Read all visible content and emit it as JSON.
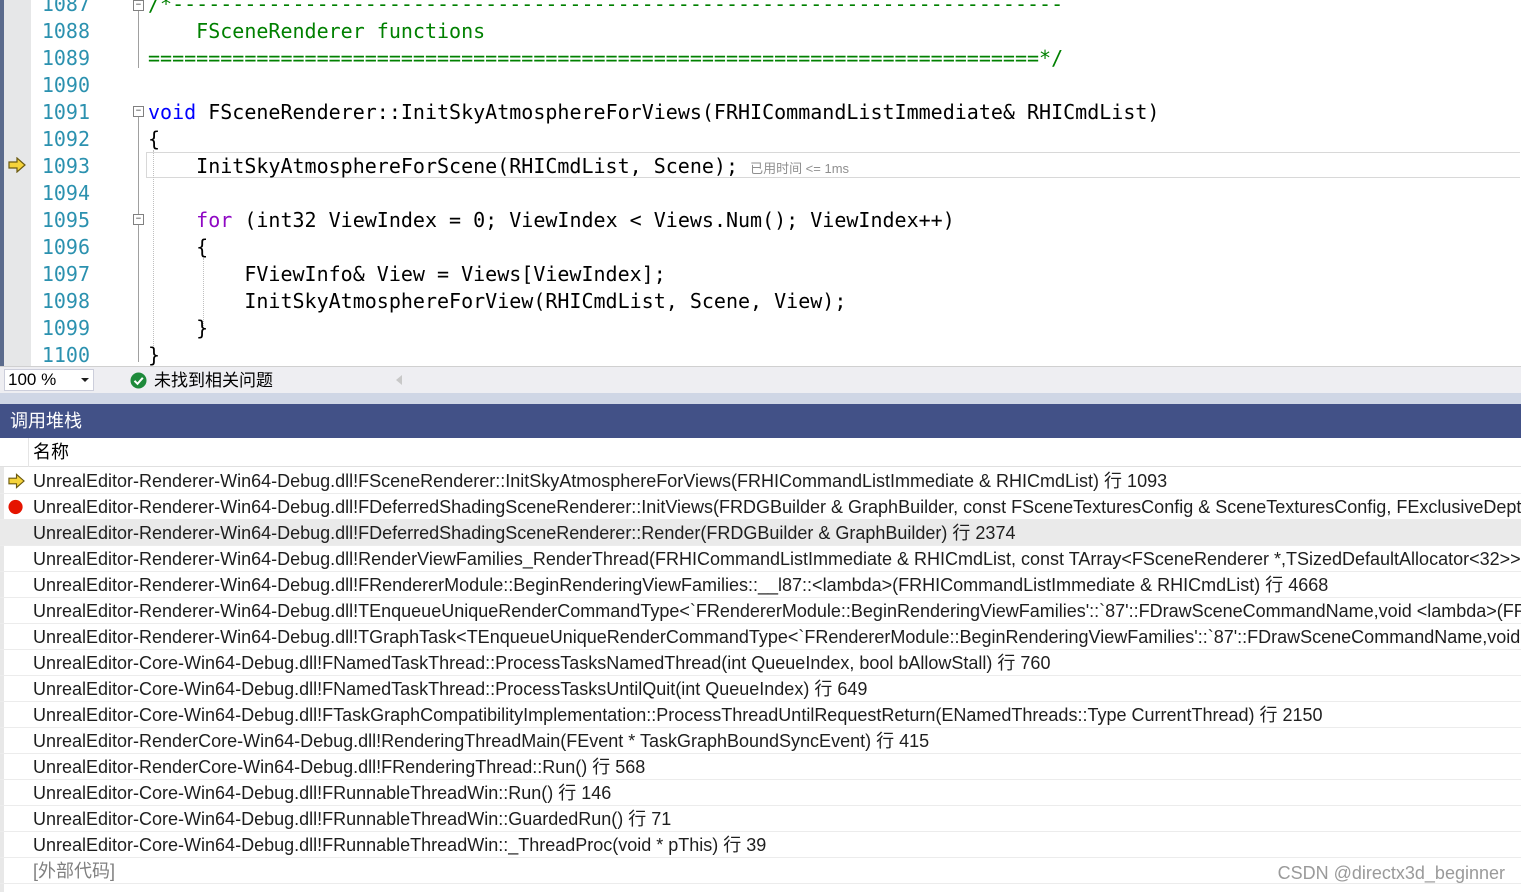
{
  "editor": {
    "lines": [
      {
        "num": "1087",
        "text": "/*--------------------------------------------------------------------------"
      },
      {
        "num": "1088",
        "text": "    FSceneRenderer functions"
      },
      {
        "num": "1089",
        "text": "==========================================================================*/"
      },
      {
        "num": "1090",
        "text": ""
      },
      {
        "num": "1091",
        "kw": "void",
        "text": " FSceneRenderer::InitSkyAtmosphereForViews(FRHICommandListImmediate& RHICmdList)"
      },
      {
        "num": "1092",
        "text": "{"
      },
      {
        "num": "1093",
        "text": "    InitSkyAtmosphereForScene(RHICmdList, Scene);",
        "perf": "已用时间 <= 1ms"
      },
      {
        "num": "1094",
        "text": ""
      },
      {
        "num": "1095",
        "kw2": "for",
        "text": " (int32 ViewIndex = 0; ViewIndex < Views.Num(); ViewIndex++)"
      },
      {
        "num": "1096",
        "text": "    {"
      },
      {
        "num": "1097",
        "text": "        FViewInfo& View = Views[ViewIndex];"
      },
      {
        "num": "1098",
        "text": "        InitSkyAtmosphereForView(RHICmdList, Scene, View);"
      },
      {
        "num": "1099",
        "text": "    }"
      },
      {
        "num": "1100",
        "text": "}"
      }
    ]
  },
  "status_bar": {
    "zoom": "100 %",
    "issues": "未找到相关问题"
  },
  "callstack": {
    "title": "调用堆栈",
    "column_name": "名称",
    "rows": [
      {
        "text": "UnrealEditor-Renderer-Win64-Debug.dll!FSceneRenderer::InitSkyAtmosphereForViews(FRHICommandListImmediate & RHICmdList) 行 1093",
        "glyph": "current-arrow"
      },
      {
        "text": "UnrealEditor-Renderer-Win64-Debug.dll!FDeferredShadingSceneRenderer::InitViews(FRDGBuilder & GraphBuilder, const FSceneTexturesConfig & SceneTexturesConfig, FExclusiveDepthStencil",
        "glyph": "breakpoint"
      },
      {
        "text": "UnrealEditor-Renderer-Win64-Debug.dll!FDeferredShadingSceneRenderer::Render(FRDGBuilder & GraphBuilder) 行 2374",
        "glyph": "",
        "selected": true
      },
      {
        "text": "UnrealEditor-Renderer-Win64-Debug.dll!RenderViewFamilies_RenderThread(FRHICommandListImmediate & RHICmdList, const TArray<FSceneRenderer *,TSizedDefaultAllocator<32>> & Sce",
        "glyph": ""
      },
      {
        "text": "UnrealEditor-Renderer-Win64-Debug.dll!FRendererModule::BeginRenderingViewFamilies::__l87::<lambda>(FRHICommandListImmediate & RHICmdList) 行 4668",
        "glyph": ""
      },
      {
        "text": "UnrealEditor-Renderer-Win64-Debug.dll!TEnqueueUniqueRenderCommandType<`FRendererModule::BeginRenderingViewFamilies'::`87'::FDrawSceneCommandName,void <lambda>(FRHICo",
        "glyph": ""
      },
      {
        "text": "UnrealEditor-Renderer-Win64-Debug.dll!TGraphTask<TEnqueueUniqueRenderCommandType<`FRendererModule::BeginRenderingViewFamilies'::`87'::FDrawSceneCommandName,void <lamb",
        "glyph": ""
      },
      {
        "text": "UnrealEditor-Core-Win64-Debug.dll!FNamedTaskThread::ProcessTasksNamedThread(int QueueIndex, bool bAllowStall) 行 760",
        "glyph": ""
      },
      {
        "text": "UnrealEditor-Core-Win64-Debug.dll!FNamedTaskThread::ProcessTasksUntilQuit(int QueueIndex) 行 649",
        "glyph": ""
      },
      {
        "text": "UnrealEditor-Core-Win64-Debug.dll!FTaskGraphCompatibilityImplementation::ProcessThreadUntilRequestReturn(ENamedThreads::Type CurrentThread) 行 2150",
        "glyph": ""
      },
      {
        "text": "UnrealEditor-RenderCore-Win64-Debug.dll!RenderingThreadMain(FEvent * TaskGraphBoundSyncEvent) 行 415",
        "glyph": ""
      },
      {
        "text": "UnrealEditor-RenderCore-Win64-Debug.dll!FRenderingThread::Run() 行 568",
        "glyph": ""
      },
      {
        "text": "UnrealEditor-Core-Win64-Debug.dll!FRunnableThreadWin::Run() 行 146",
        "glyph": ""
      },
      {
        "text": "UnrealEditor-Core-Win64-Debug.dll!FRunnableThreadWin::GuardedRun() 行 71",
        "glyph": ""
      },
      {
        "text": "UnrealEditor-Core-Win64-Debug.dll!FRunnableThreadWin::_ThreadProc(void * pThis) 行 39",
        "glyph": ""
      },
      {
        "text": "[外部代码]",
        "glyph": "",
        "external": true
      }
    ]
  },
  "watermark": "CSDN @directx3d_beginner",
  "colors": {
    "line_number": "#2b91af",
    "comment": "#008000",
    "keyword": "#0000ff",
    "control_keyword": "#8f08c4",
    "panel_title_bg": "#425187",
    "breakpoint": "#e51400",
    "exec_arrow": "#f5d33a"
  }
}
